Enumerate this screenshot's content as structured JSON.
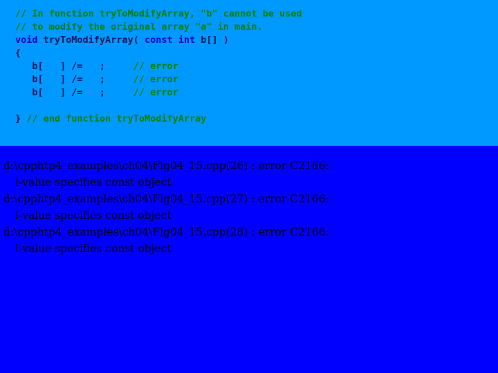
{
  "colors": {
    "code_panel_background": "#0099FF",
    "output_panel_background": "#0000FF",
    "comment": "#008000",
    "keyword": "#0000CC",
    "identifier": "#0A1A5E",
    "error_text": "#000000"
  },
  "code_panel": {
    "lines": [
      {
        "id": "comment-line-1",
        "blank": false,
        "tokens": [
          {
            "text": "// In function tryToModifyArray, \"b\" cannot be used",
            "kind": "comment"
          }
        ]
      },
      {
        "id": "comment-line-2",
        "blank": false,
        "tokens": [
          {
            "text": "// to modify the original array \"a\" in main.",
            "kind": "comment"
          }
        ]
      },
      {
        "id": "function-signature",
        "blank": false,
        "tokens": [
          {
            "text": "void",
            "kind": "keyword"
          },
          {
            "text": " ",
            "kind": "punct"
          },
          {
            "text": "tryToModifyArray(",
            "kind": "ident"
          },
          {
            "text": " ",
            "kind": "punct"
          },
          {
            "text": "const",
            "kind": "keyword"
          },
          {
            "text": " ",
            "kind": "punct"
          },
          {
            "text": "int",
            "kind": "keyword"
          },
          {
            "text": " ",
            "kind": "punct"
          },
          {
            "text": "b[] )",
            "kind": "ident"
          }
        ]
      },
      {
        "id": "open-brace",
        "blank": false,
        "tokens": [
          {
            "text": "{",
            "kind": "punct"
          }
        ]
      },
      {
        "id": "statement-line-1",
        "blank": false,
        "tokens": [
          {
            "text": "   b[   ] /=   ;     ",
            "kind": "ident"
          },
          {
            "text": "// error",
            "kind": "comment"
          }
        ]
      },
      {
        "id": "statement-line-2",
        "blank": false,
        "tokens": [
          {
            "text": "   b[   ] /=   ;     ",
            "kind": "ident"
          },
          {
            "text": "// error",
            "kind": "comment"
          }
        ]
      },
      {
        "id": "statement-line-3",
        "blank": false,
        "tokens": [
          {
            "text": "   b[   ] /=   ;     ",
            "kind": "ident"
          },
          {
            "text": "// error",
            "kind": "comment"
          }
        ]
      },
      {
        "id": "spacer-line",
        "blank": true,
        "tokens": [
          {
            "text": " ",
            "kind": "punct"
          }
        ]
      },
      {
        "id": "close-brace-line",
        "blank": false,
        "tokens": [
          {
            "text": "}",
            "kind": "punct"
          },
          {
            "text": " ",
            "kind": "punct"
          },
          {
            "text": "// end function tryToModifyArray",
            "kind": "comment"
          }
        ]
      }
    ]
  },
  "output_panel": {
    "errors": [
      {
        "path": "d:\\cpphtp4_examples\\ch04\\Fig04_15.cpp(26) : error C2166:",
        "message": "l-value specifies const object"
      },
      {
        "path": "d:\\cpphtp4_examples\\ch04\\Fig04_15.cpp(27) : error C2166:",
        "message": "l-value specifies const object"
      },
      {
        "path": "d:\\cpphtp4_examples\\ch04\\Fig04_15.cpp(28) : error C2166:",
        "message": "l-value specifies const object"
      }
    ]
  }
}
